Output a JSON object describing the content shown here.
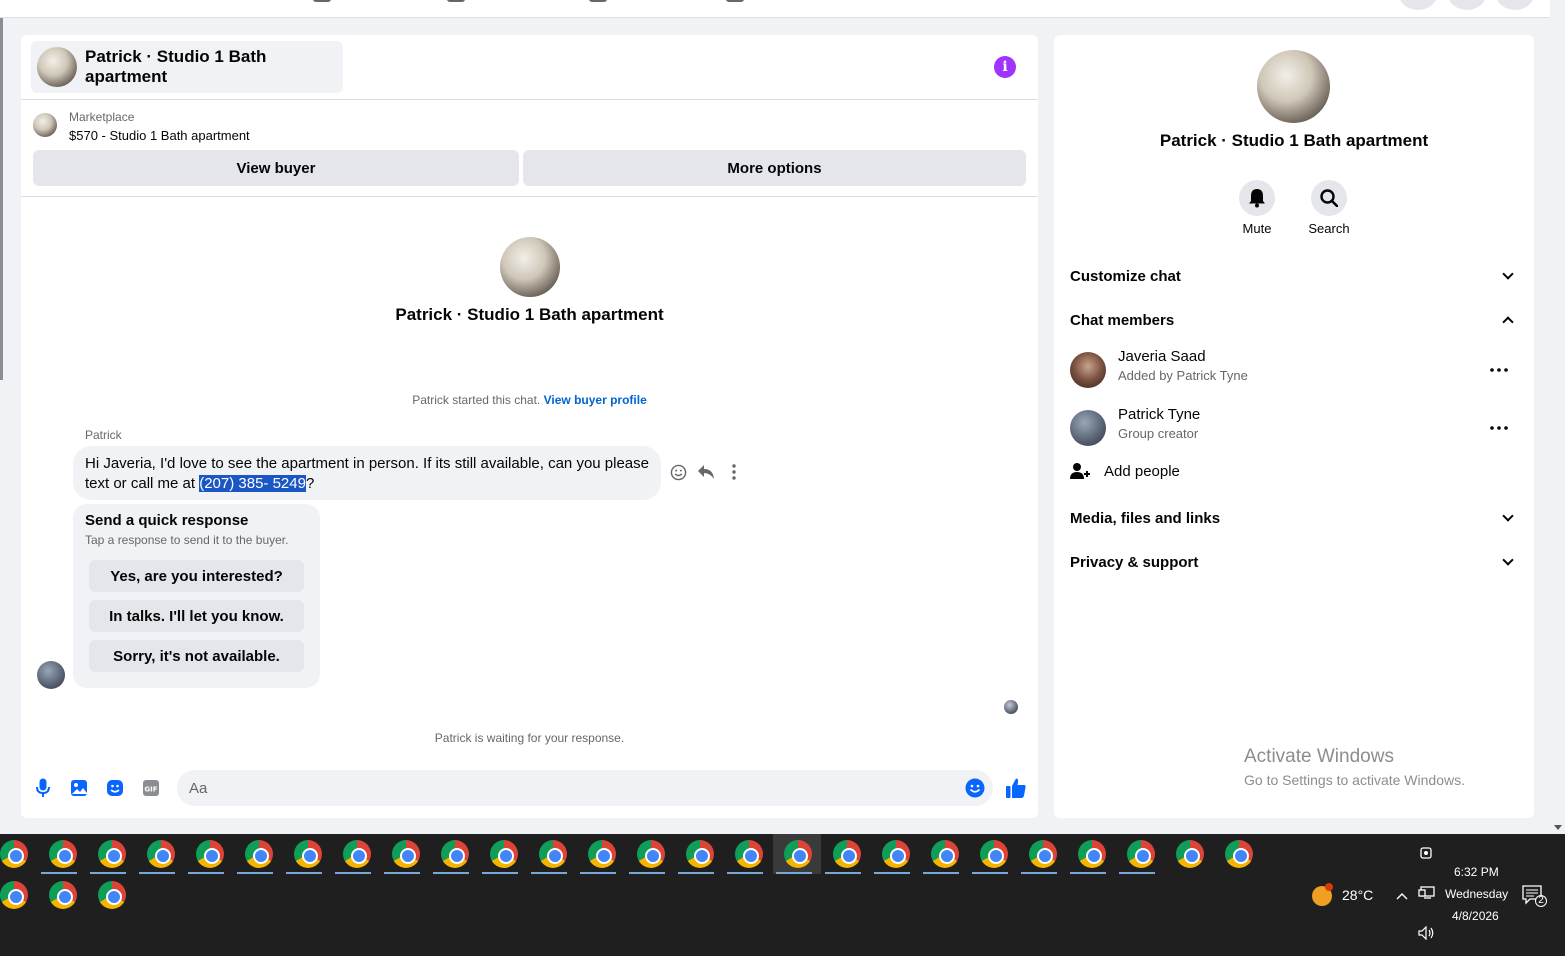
{
  "chat": {
    "title": "Patrick · Studio 1 Bath apartment",
    "marketplace_label": "Marketplace",
    "listing": "$570 - Studio 1 Bath apartment",
    "view_buyer": "View buyer",
    "more_options": "More options",
    "center_title": "Patrick · Studio 1 Bath apartment",
    "started_text": "Patrick started this chat.",
    "view_buyer_profile": "View buyer profile",
    "sender": "Patrick",
    "message_before": "Hi Javeria, I'd love to see the apartment in person. If its still available, can you please text or call me at ",
    "message_phone": "(207) 385- 5249",
    "message_after": "?",
    "quick_title": "Send a quick response",
    "quick_subtitle": "Tap a response to send it to the buyer.",
    "quick_responses": [
      "Yes, are you interested?",
      "In talks. I'll let you know.",
      "Sorry, it's not available."
    ],
    "waiting": "Patrick is waiting for your response.",
    "composer_placeholder": "Aa"
  },
  "details": {
    "title": "Patrick · Studio 1 Bath apartment",
    "mute": "Mute",
    "search": "Search",
    "customize_chat": "Customize chat",
    "chat_members": "Chat members",
    "members": [
      {
        "name": "Javeria Saad",
        "sub": "Added by Patrick Tyne"
      },
      {
        "name": "Patrick Tyne",
        "sub": "Group creator"
      }
    ],
    "add_people": "Add people",
    "media": "Media, files and links",
    "privacy": "Privacy & support"
  },
  "watermark": {
    "line1": "Activate Windows",
    "line2": "Go to Settings to activate Windows."
  },
  "taskbar": {
    "temperature": "28°C",
    "time": "6:32 PM",
    "day": "Wednesday",
    "date": "4/8/2026",
    "notification_count": "2"
  },
  "colors": {
    "accent": "#0866ff",
    "info": "#a033ff",
    "link": "#0064d1"
  }
}
